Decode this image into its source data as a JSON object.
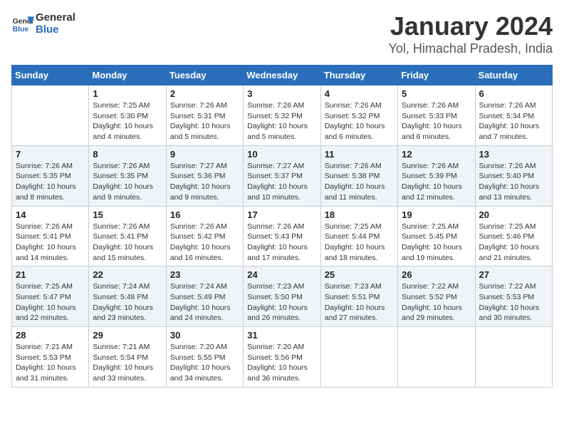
{
  "header": {
    "logo_text_general": "General",
    "logo_text_blue": "Blue",
    "month_title": "January 2024",
    "location": "Yol, Himachal Pradesh, India"
  },
  "days_of_week": [
    "Sunday",
    "Monday",
    "Tuesday",
    "Wednesday",
    "Thursday",
    "Friday",
    "Saturday"
  ],
  "weeks": [
    [
      {
        "day": "",
        "info": ""
      },
      {
        "day": "1",
        "info": "Sunrise: 7:25 AM\nSunset: 5:30 PM\nDaylight: 10 hours\nand 4 minutes."
      },
      {
        "day": "2",
        "info": "Sunrise: 7:26 AM\nSunset: 5:31 PM\nDaylight: 10 hours\nand 5 minutes."
      },
      {
        "day": "3",
        "info": "Sunrise: 7:26 AM\nSunset: 5:32 PM\nDaylight: 10 hours\nand 5 minutes."
      },
      {
        "day": "4",
        "info": "Sunrise: 7:26 AM\nSunset: 5:32 PM\nDaylight: 10 hours\nand 6 minutes."
      },
      {
        "day": "5",
        "info": "Sunrise: 7:26 AM\nSunset: 5:33 PM\nDaylight: 10 hours\nand 6 minutes."
      },
      {
        "day": "6",
        "info": "Sunrise: 7:26 AM\nSunset: 5:34 PM\nDaylight: 10 hours\nand 7 minutes."
      }
    ],
    [
      {
        "day": "7",
        "info": "Sunrise: 7:26 AM\nSunset: 5:35 PM\nDaylight: 10 hours\nand 8 minutes."
      },
      {
        "day": "8",
        "info": "Sunrise: 7:26 AM\nSunset: 5:35 PM\nDaylight: 10 hours\nand 9 minutes."
      },
      {
        "day": "9",
        "info": "Sunrise: 7:27 AM\nSunset: 5:36 PM\nDaylight: 10 hours\nand 9 minutes."
      },
      {
        "day": "10",
        "info": "Sunrise: 7:27 AM\nSunset: 5:37 PM\nDaylight: 10 hours\nand 10 minutes."
      },
      {
        "day": "11",
        "info": "Sunrise: 7:26 AM\nSunset: 5:38 PM\nDaylight: 10 hours\nand 11 minutes."
      },
      {
        "day": "12",
        "info": "Sunrise: 7:26 AM\nSunset: 5:39 PM\nDaylight: 10 hours\nand 12 minutes."
      },
      {
        "day": "13",
        "info": "Sunrise: 7:26 AM\nSunset: 5:40 PM\nDaylight: 10 hours\nand 13 minutes."
      }
    ],
    [
      {
        "day": "14",
        "info": "Sunrise: 7:26 AM\nSunset: 5:41 PM\nDaylight: 10 hours\nand 14 minutes."
      },
      {
        "day": "15",
        "info": "Sunrise: 7:26 AM\nSunset: 5:41 PM\nDaylight: 10 hours\nand 15 minutes."
      },
      {
        "day": "16",
        "info": "Sunrise: 7:26 AM\nSunset: 5:42 PM\nDaylight: 10 hours\nand 16 minutes."
      },
      {
        "day": "17",
        "info": "Sunrise: 7:26 AM\nSunset: 5:43 PM\nDaylight: 10 hours\nand 17 minutes."
      },
      {
        "day": "18",
        "info": "Sunrise: 7:25 AM\nSunset: 5:44 PM\nDaylight: 10 hours\nand 18 minutes."
      },
      {
        "day": "19",
        "info": "Sunrise: 7:25 AM\nSunset: 5:45 PM\nDaylight: 10 hours\nand 19 minutes."
      },
      {
        "day": "20",
        "info": "Sunrise: 7:25 AM\nSunset: 5:46 PM\nDaylight: 10 hours\nand 21 minutes."
      }
    ],
    [
      {
        "day": "21",
        "info": "Sunrise: 7:25 AM\nSunset: 5:47 PM\nDaylight: 10 hours\nand 22 minutes."
      },
      {
        "day": "22",
        "info": "Sunrise: 7:24 AM\nSunset: 5:48 PM\nDaylight: 10 hours\nand 23 minutes."
      },
      {
        "day": "23",
        "info": "Sunrise: 7:24 AM\nSunset: 5:49 PM\nDaylight: 10 hours\nand 24 minutes."
      },
      {
        "day": "24",
        "info": "Sunrise: 7:23 AM\nSunset: 5:50 PM\nDaylight: 10 hours\nand 26 minutes."
      },
      {
        "day": "25",
        "info": "Sunrise: 7:23 AM\nSunset: 5:51 PM\nDaylight: 10 hours\nand 27 minutes."
      },
      {
        "day": "26",
        "info": "Sunrise: 7:22 AM\nSunset: 5:52 PM\nDaylight: 10 hours\nand 29 minutes."
      },
      {
        "day": "27",
        "info": "Sunrise: 7:22 AM\nSunset: 5:53 PM\nDaylight: 10 hours\nand 30 minutes."
      }
    ],
    [
      {
        "day": "28",
        "info": "Sunrise: 7:21 AM\nSunset: 5:53 PM\nDaylight: 10 hours\nand 31 minutes."
      },
      {
        "day": "29",
        "info": "Sunrise: 7:21 AM\nSunset: 5:54 PM\nDaylight: 10 hours\nand 33 minutes."
      },
      {
        "day": "30",
        "info": "Sunrise: 7:20 AM\nSunset: 5:55 PM\nDaylight: 10 hours\nand 34 minutes."
      },
      {
        "day": "31",
        "info": "Sunrise: 7:20 AM\nSunset: 5:56 PM\nDaylight: 10 hours\nand 36 minutes."
      },
      {
        "day": "",
        "info": ""
      },
      {
        "day": "",
        "info": ""
      },
      {
        "day": "",
        "info": ""
      }
    ]
  ]
}
